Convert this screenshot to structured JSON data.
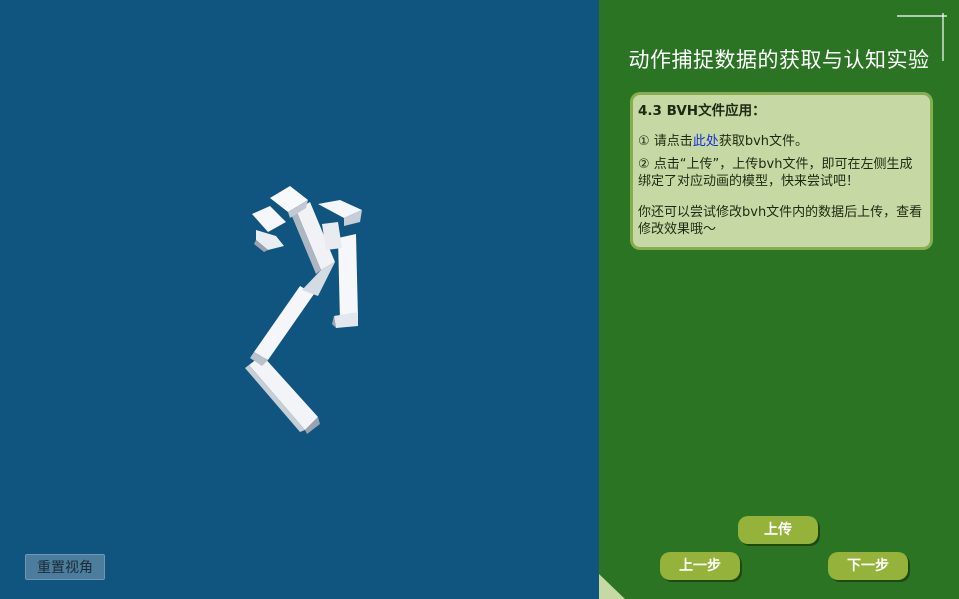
{
  "viewport": {
    "background_color": "#0f5580",
    "reset_button_label": "重置视角"
  },
  "panel": {
    "background_color": "#2a7424",
    "title": "动作捕捉数据的获取与认知实验",
    "card": {
      "heading": "4.3  BVH文件应用：",
      "step1_prefix": "①  请点击",
      "step1_link": "此处",
      "step1_suffix": "获取bvh文件。",
      "step2": "②  点击“上传”，上传bvh文件，即可在左侧生成绑定了对应动画的模型，快来尝试吧！",
      "note": "你还可以尝试修改bvh文件内的数据后上传，查看修改效果哦～"
    },
    "buttons": {
      "upload": "上传",
      "prev": "上一步",
      "next": "下一步"
    },
    "accent_color": "#95b33b"
  }
}
